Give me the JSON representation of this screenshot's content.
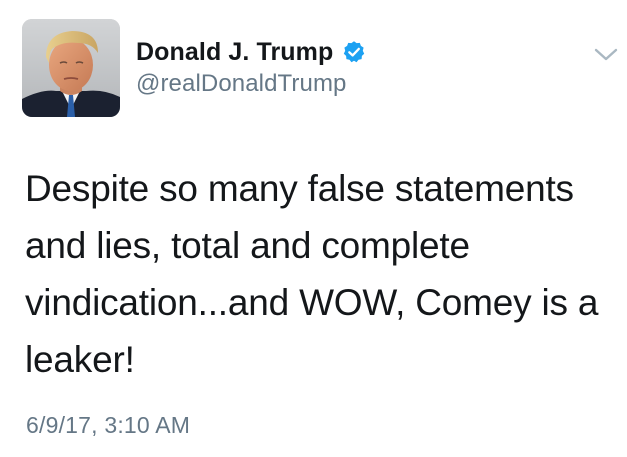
{
  "user": {
    "display_name": "Donald J. Trump",
    "handle": "@realDonaldTrump",
    "verified": true
  },
  "icons": {
    "verified": "verified-badge-icon",
    "menu": "chevron-down-icon",
    "avatar": "profile-photo"
  },
  "tweet": {
    "text": "Despite so many false statements and lies, total and complete vindication...and WOW, Comey is a leaker!",
    "timestamp": "6/9/17, 3:10 AM"
  },
  "colors": {
    "text": "#14171a",
    "secondary": "#657786",
    "verified_blue": "#1da1f2",
    "chevron": "#aab8c2",
    "background": "#ffffff"
  }
}
